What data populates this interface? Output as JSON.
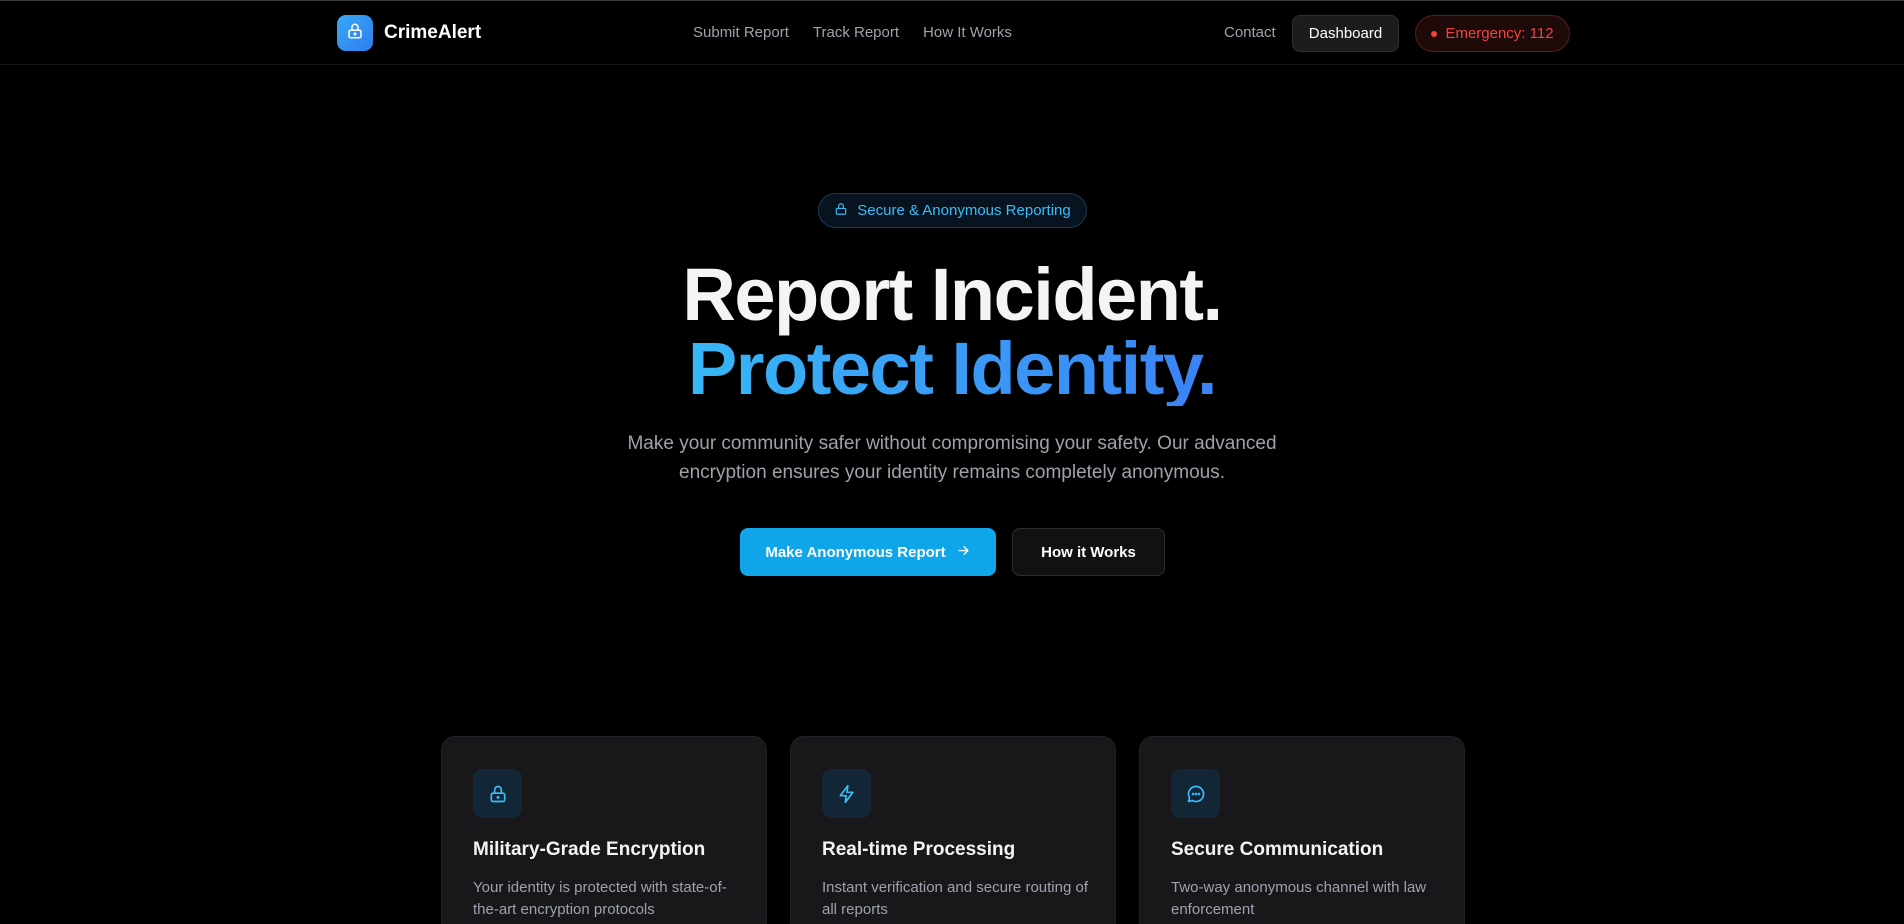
{
  "app": {
    "brand": "CrimeAlert",
    "logo_icon": "lock-icon"
  },
  "nav": {
    "links": [
      {
        "label": "Submit Report"
      },
      {
        "label": "Track Report"
      },
      {
        "label": "How It Works"
      }
    ],
    "contact": "Contact",
    "dashboard": "Dashboard",
    "emergency": "Emergency: 112"
  },
  "hero": {
    "badge": "Secure & Anonymous Reporting",
    "badge_icon": "lock-icon",
    "title_line1": "Report Incident.",
    "title_line2": "Protect Identity.",
    "subtitle": "Make your community safer without compromising your safety. Our advanced encryption ensures your identity remains completely anonymous.",
    "primary_button": "Make Anonymous Report",
    "primary_button_icon": "arrow-right-icon",
    "secondary_button": "How it Works"
  },
  "features": [
    {
      "icon": "lock-icon",
      "title": "Military-Grade Encryption",
      "description": "Your identity is protected with state-of-the-art encryption protocols"
    },
    {
      "icon": "lightning-icon",
      "title": "Real-time Processing",
      "description": "Instant verification and secure routing of all reports"
    },
    {
      "icon": "chat-bubble-icon",
      "title": "Secure Communication",
      "description": "Two-way anonymous channel with law enforcement"
    }
  ],
  "colors": {
    "background": "#000000",
    "accent": "#0ea5e9",
    "accent_gradient_start": "#38b6f6",
    "accent_gradient_end": "#3b82f6",
    "emergency": "#ef4444",
    "card": "#18181b"
  }
}
